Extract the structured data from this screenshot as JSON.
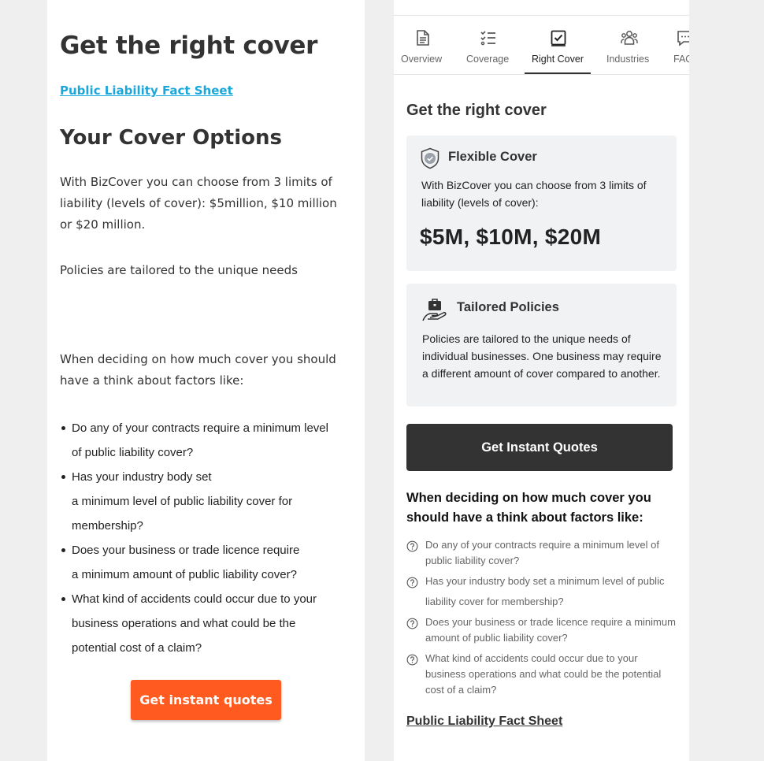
{
  "left": {
    "title": "Get the right cover",
    "fact_sheet_link": "Public Liability Fact Sheet",
    "options_heading": "Your Cover Options",
    "intro": "With BizCover you can choose from 3 limits of liability (levels of cover): $5million, $10 million or $20 million.",
    "tailored": "Policies are tailored to the unique needs",
    "deciding": "When deciding on how much cover you should have a think about factors like:",
    "factors": [
      [
        "Do any of your contracts require a minimum level",
        "of public liability cover?"
      ],
      [
        "Has your industry body set",
        "a minimum level of public liability cover for",
        "membership?"
      ],
      [
        "Does your business or trade licence require",
        "a minimum amount of public liability cover?"
      ],
      [
        "What kind of accidents could occur due to your",
        "business operations and what could be the",
        "potential cost of a claim?"
      ]
    ],
    "cta": "Get instant quotes"
  },
  "right": {
    "tabs": [
      {
        "label": "Overview",
        "icon": "document-icon",
        "active": false
      },
      {
        "label": "Coverage",
        "icon": "checklist-icon",
        "active": false
      },
      {
        "label": "Right Cover",
        "icon": "checkbox-icon",
        "active": true
      },
      {
        "label": "Industries",
        "icon": "people-icon",
        "active": false
      },
      {
        "label": "FAQ",
        "icon": "chat-icon",
        "active": false
      }
    ],
    "title": "Get the right cover",
    "flexible": {
      "title": "Flexible Cover",
      "text": "With BizCover you can choose from 3 limits of liability (levels of cover):",
      "limits": "$5M, $10M, $20M",
      "icon": "shield-check-icon"
    },
    "tailored": {
      "title": "Tailored Policies",
      "text": "Policies are tailored to the unique needs of individual businesses. One business may require a different amount of cover compared to another.",
      "icon": "hand-briefcase-icon"
    },
    "cta": "Get Instant Quotes",
    "deciding": "When deciding on how much cover you should have a think about factors like:",
    "factors": [
      "Do any of your contracts require a minimum level of public liability cover?",
      "Has your industry body set a minimum level of public liability cover for membership?",
      "Does your business or trade licence require a minimum amount of public liability cover?",
      "What kind of accidents could occur due to your business operations and what could be the potential cost of a claim?"
    ],
    "fact_sheet_link": "Public Liability Fact Sheet"
  },
  "colors": {
    "link_blue": "#1aa7d9",
    "orange_cta": "#ff5a1f",
    "dark_cta": "#333333",
    "card_bg": "#f1f2f4"
  }
}
